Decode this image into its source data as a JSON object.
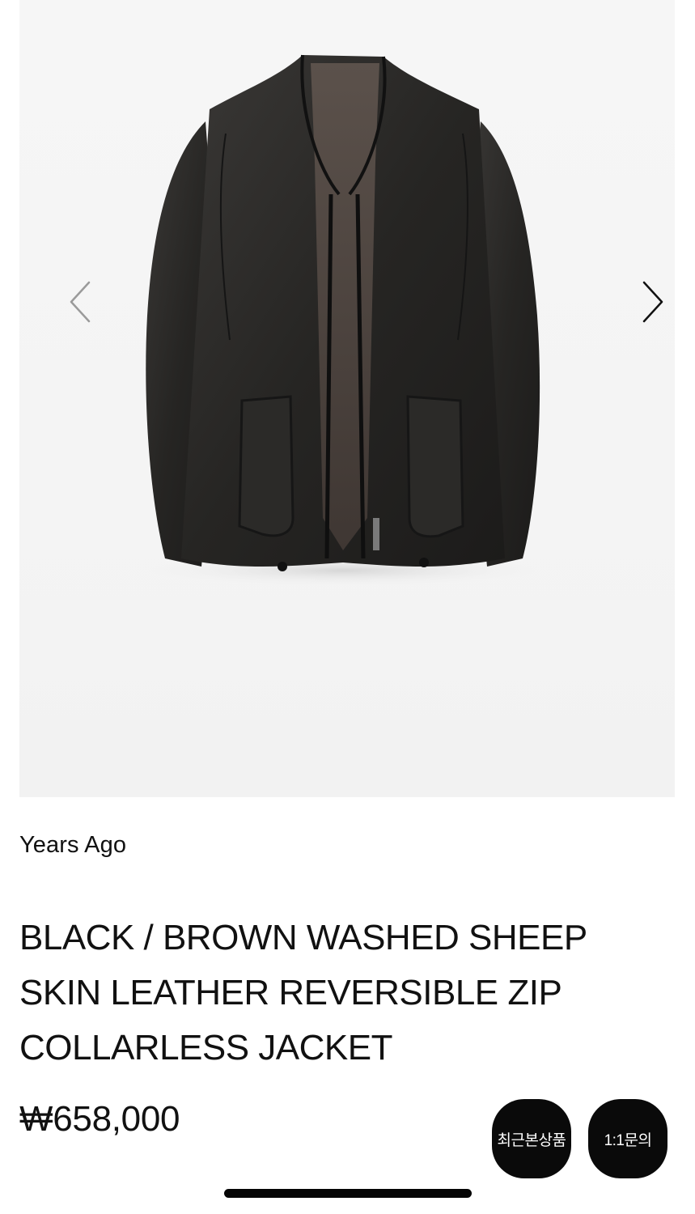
{
  "gallery": {
    "image_alt": "Black leather reversible zip collarless jacket",
    "prev_icon": "chevron-left-icon",
    "next_icon": "chevron-right-icon"
  },
  "product": {
    "brand": "Years Ago",
    "title": "BLACK / BROWN WASHED SHEEP SKIN LEATHER REVERSIBLE ZIP COLLARLESS JACKET",
    "price": "₩658,000"
  },
  "floating_buttons": {
    "recent_label": "최근본상품",
    "inquiry_label": "1:1문의"
  },
  "colors": {
    "background": "#ffffff",
    "gallery_bg": "#f4f4f4",
    "button_bg": "#0a0a0a",
    "text": "#111111"
  }
}
